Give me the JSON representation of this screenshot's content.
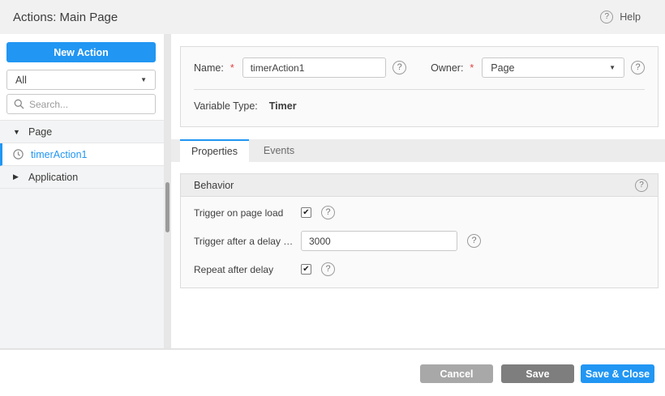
{
  "header": {
    "title": "Actions: Main Page",
    "help_label": "Help"
  },
  "sidebar": {
    "new_action_label": "New Action",
    "filter_value": "All",
    "search_placeholder": "Search...",
    "tree": [
      {
        "label": "Page",
        "type": "group",
        "state": "expanded"
      },
      {
        "label": "timerAction1",
        "type": "timer-action",
        "selected": true
      },
      {
        "label": "Application",
        "type": "group",
        "state": "collapsed"
      }
    ]
  },
  "form": {
    "name_label": "Name:",
    "name_value": "timerAction1",
    "owner_label": "Owner:",
    "owner_value": "Page",
    "required_marker": "*",
    "variable_type_label": "Variable Type:",
    "variable_type_value": "Timer"
  },
  "tabs": [
    {
      "label": "Properties",
      "active": true
    },
    {
      "label": "Events",
      "active": false
    }
  ],
  "behavior": {
    "title": "Behavior",
    "rows": [
      {
        "label": "Trigger on page load",
        "control": "checkbox",
        "checked": true
      },
      {
        "label": "Trigger after a delay (millisec…",
        "control": "input",
        "value": "3000"
      },
      {
        "label": "Repeat after delay",
        "control": "checkbox",
        "checked": true
      }
    ]
  },
  "footer": {
    "cancel_label": "Cancel",
    "save_label": "Save",
    "save_close_label": "Save & Close"
  },
  "icons": {
    "help_glyph": "?",
    "expanded_glyph": "▼",
    "collapsed_glyph": "▶",
    "dropdown_glyph": "▼",
    "checkbox_check_glyph": "✔"
  },
  "colors": {
    "accent_blue": "#2196f3",
    "cancel_button_gray": "#a8a8a8",
    "save_button_gray": "#7e7e7e",
    "selected_text_blue": "#2196f3"
  }
}
